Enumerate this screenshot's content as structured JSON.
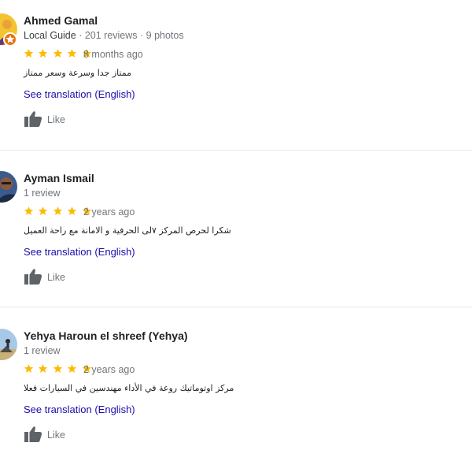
{
  "reviews": [
    {
      "name": "Ahmed Gamal",
      "badge": "Local Guide",
      "stats": "· 201 reviews · 9 photos",
      "rating": 5,
      "age": "8 months ago",
      "text": "ممتاز جدا وسرعة وسعر ممتاز",
      "translate": "See translation (English)",
      "like": "Like",
      "avatar_icon": "person-photo-yellow",
      "avatar_color": "#f4c430"
    },
    {
      "name": "Ayman Ismail",
      "badge": "",
      "stats": "1 review",
      "rating": 5,
      "age": "2 years ago",
      "text": "شكرا لحرص المركز ٧لى الحرفية و الامانة مع راحة العميل",
      "translate": "See translation (English)",
      "like": "Like",
      "avatar_icon": "person-photo-blue",
      "avatar_color": "#3b5b8c"
    },
    {
      "name": "Yehya Haroun el shreef (Yehya)",
      "badge": "",
      "stats": "1 review",
      "rating": 5,
      "age": "2 years ago",
      "text": "مركز اوتوماتيك روعة في الأداء مهندسين في السيارات فعلا",
      "translate": "See translation (English)",
      "like": "Like",
      "avatar_icon": "person-photo-outdoor",
      "avatar_color": "#a8c8e8"
    }
  ],
  "colors": {
    "star": "#fbbc04",
    "link": "#1a0dab",
    "secondary_text": "#70757a",
    "thumb": "#5f6368",
    "local_guide_badge": "#e8710a"
  }
}
